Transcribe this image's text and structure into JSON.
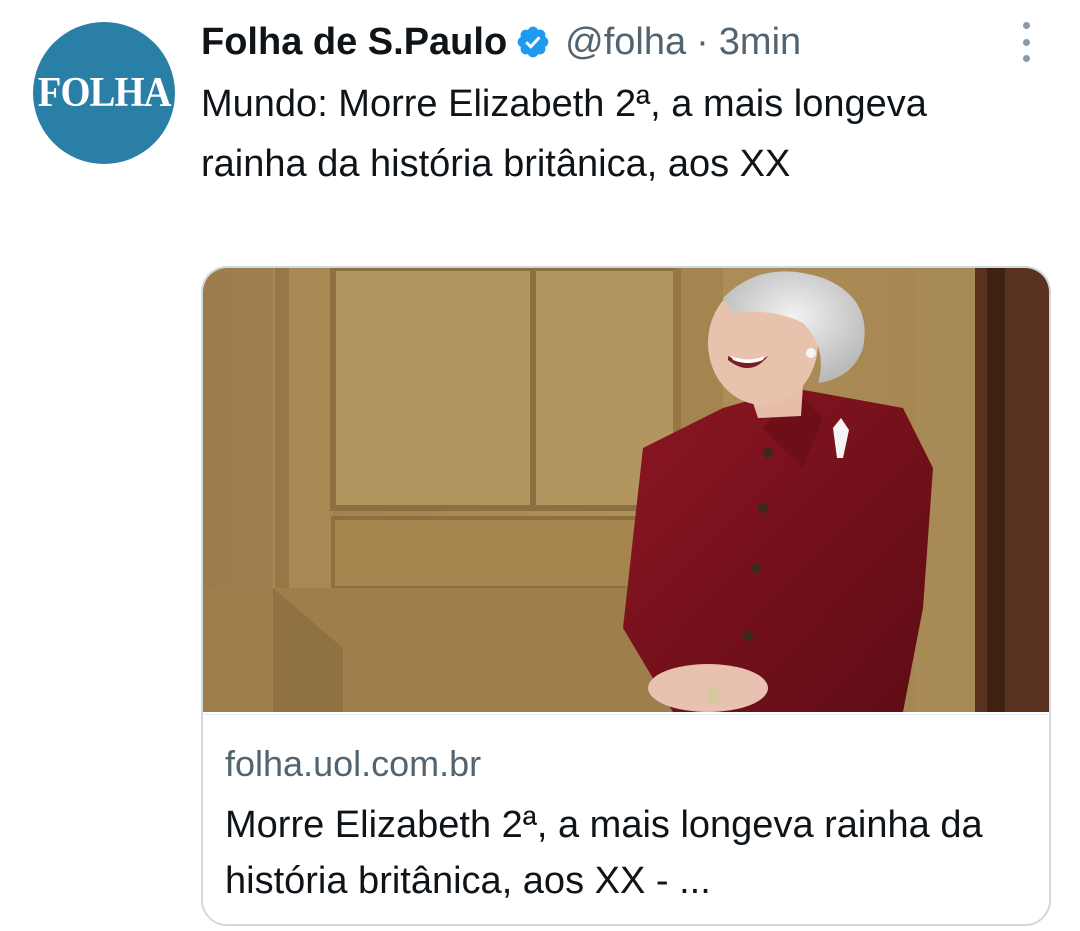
{
  "account": {
    "avatar_text": "FOLHA",
    "display_name": "Folha de S.Paulo",
    "handle": "@folha",
    "separator": "·",
    "time": "3min",
    "verified_icon": "verified-badge-icon",
    "colors": {
      "avatar_bg": "#2a7fa6",
      "verified": "#1d9bf0"
    }
  },
  "tweet": {
    "text": "Mundo: Morre Elizabeth 2ª, a mais longeva rainha da história britânica, aos XX"
  },
  "menu": {
    "icon": "more-vertical-icon"
  },
  "link_card": {
    "image_icon": "news-photo-image",
    "domain": "folha.uol.com.br",
    "title": "Morre Elizabeth 2ª, a mais longeva rainha da história britânica, aos XX - ..."
  }
}
